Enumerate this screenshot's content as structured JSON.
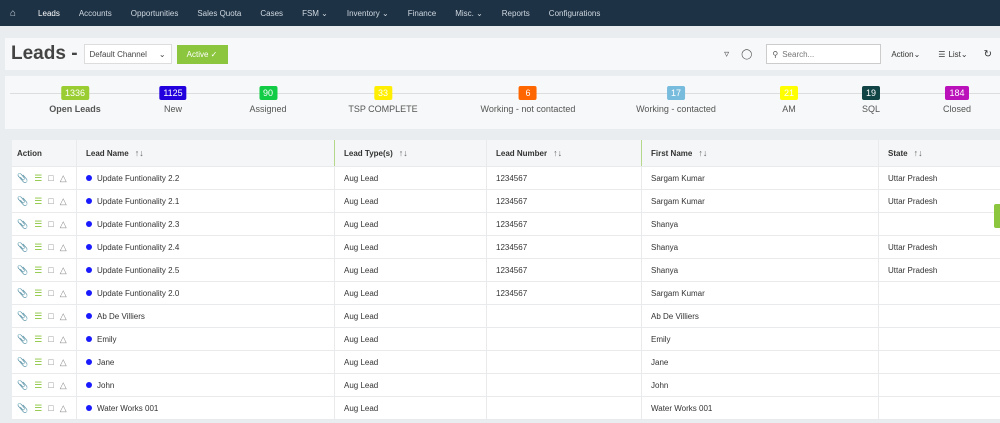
{
  "nav": {
    "items": [
      {
        "label": "Leads",
        "active": true
      },
      {
        "label": "Accounts"
      },
      {
        "label": "Opportunities"
      },
      {
        "label": "Sales Quota"
      },
      {
        "label": "Cases"
      },
      {
        "label": "FSM ⌄"
      },
      {
        "label": "Inventory ⌄"
      },
      {
        "label": "Finance"
      },
      {
        "label": "Misc. ⌄"
      },
      {
        "label": "Reports"
      },
      {
        "label": "Configurations"
      }
    ]
  },
  "header": {
    "title": "Leads -",
    "channel": "Default Channel",
    "active_label": "Active ✓",
    "search_placeholder": "Search...",
    "action_label": "Action⌄",
    "list_label": "List⌄"
  },
  "stages": [
    {
      "count": "1336",
      "label": "Open Leads",
      "color": "#9acd32"
    },
    {
      "count": "1125",
      "label": "New",
      "color": "#2200dd"
    },
    {
      "count": "90",
      "label": "Assigned",
      "color": "#11cc44"
    },
    {
      "count": "33",
      "label": "TSP COMPLETE",
      "color": "#ffee00"
    },
    {
      "count": "6",
      "label": "Working - not contacted",
      "color": "#ff6600"
    },
    {
      "count": "17",
      "label": "Working - contacted",
      "color": "#77bbdd"
    },
    {
      "count": "21",
      "label": "AM",
      "color": "#ffff00"
    },
    {
      "count": "19",
      "label": "SQL",
      "color": "#114444"
    },
    {
      "count": "184",
      "label": "Closed",
      "color": "#bb11bb"
    }
  ],
  "table": {
    "columns": [
      "Action",
      "Lead Name",
      "Lead Type(s)",
      "Lead Number",
      "First Name",
      "State"
    ],
    "rows": [
      [
        "Update Funtionality 2.2",
        "Aug Lead",
        "1234567",
        "Sargam Kumar",
        "Uttar Pradesh"
      ],
      [
        "Update Funtionality 2.1",
        "Aug Lead",
        "1234567",
        "Sargam Kumar",
        "Uttar Pradesh"
      ],
      [
        "Update Funtionality 2.3",
        "Aug Lead",
        "1234567",
        "Shanya",
        ""
      ],
      [
        "Update Funtionality 2.4",
        "Aug Lead",
        "1234567",
        "Shanya",
        "Uttar Pradesh"
      ],
      [
        "Update Funtionality 2.5",
        "Aug Lead",
        "1234567",
        "Shanya",
        "Uttar Pradesh"
      ],
      [
        "Update Funtionality 2.0",
        "Aug Lead",
        "1234567",
        "Sargam Kumar",
        ""
      ],
      [
        "Ab De Villiers",
        "Aug Lead",
        "",
        "Ab De Villiers",
        ""
      ],
      [
        "Emily",
        "Aug Lead",
        "",
        "Emily",
        ""
      ],
      [
        "Jane",
        "Aug Lead",
        "",
        "Jane",
        ""
      ],
      [
        "John",
        "Aug Lead",
        "",
        "John",
        ""
      ],
      [
        "Water Works 001",
        "Aug Lead",
        "",
        "Water Works 001",
        ""
      ]
    ]
  }
}
